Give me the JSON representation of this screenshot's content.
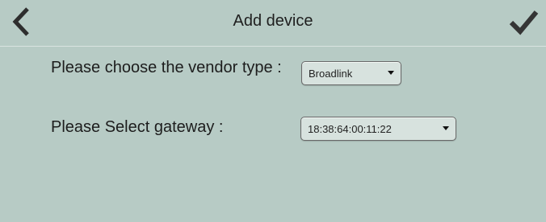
{
  "header": {
    "title": "Add device",
    "back_icon": "chevron-left-icon",
    "confirm_icon": "check-icon"
  },
  "form": {
    "vendor_label": "Please choose the vendor type :",
    "vendor_value": "Broadlink",
    "gateway_label": "Please Select gateway :",
    "gateway_value": "18:38:64:00:11:22"
  }
}
